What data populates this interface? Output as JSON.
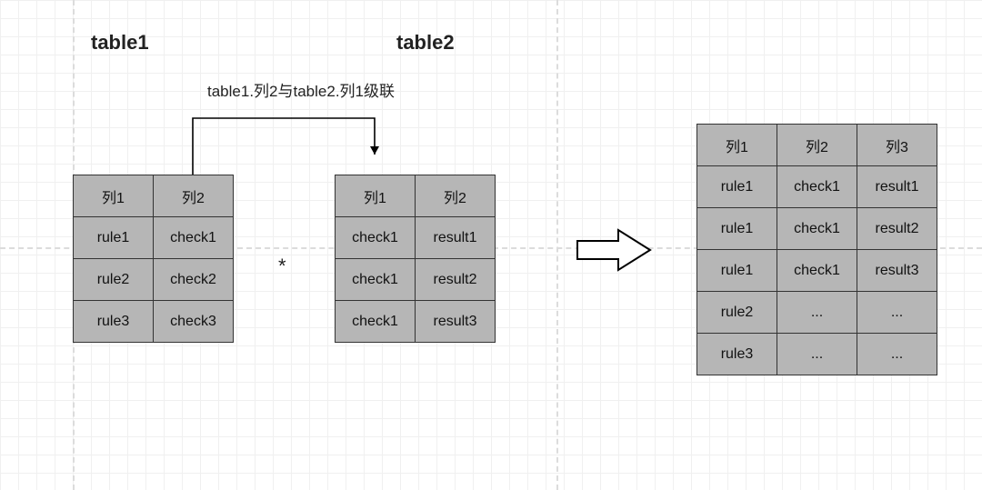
{
  "titles": {
    "t1": "table1",
    "t2": "table2"
  },
  "annotation": "table1.列2与table2.列1级联",
  "operator": "*",
  "tables": {
    "t1": {
      "headers": [
        "列1",
        "列2"
      ],
      "rows": [
        [
          "rule1",
          "check1"
        ],
        [
          "rule2",
          "check2"
        ],
        [
          "rule3",
          "check3"
        ]
      ]
    },
    "t2": {
      "headers": [
        "列1",
        "列2"
      ],
      "rows": [
        [
          "check1",
          "result1"
        ],
        [
          "check1",
          "result2"
        ],
        [
          "check1",
          "result3"
        ]
      ]
    },
    "t3": {
      "headers": [
        "列1",
        "列2",
        "列3"
      ],
      "rows": [
        [
          "rule1",
          "check1",
          "result1"
        ],
        [
          "rule1",
          "check1",
          "result2"
        ],
        [
          "rule1",
          "check1",
          "result3"
        ],
        [
          "rule2",
          "...",
          "..."
        ],
        [
          "rule3",
          "...",
          "..."
        ]
      ]
    }
  },
  "layout": {
    "col_w": {
      "t1": 88,
      "t2": 88,
      "t3": 88
    },
    "row_h": {
      "t1": 46,
      "t2": 46,
      "t3": 46
    }
  }
}
